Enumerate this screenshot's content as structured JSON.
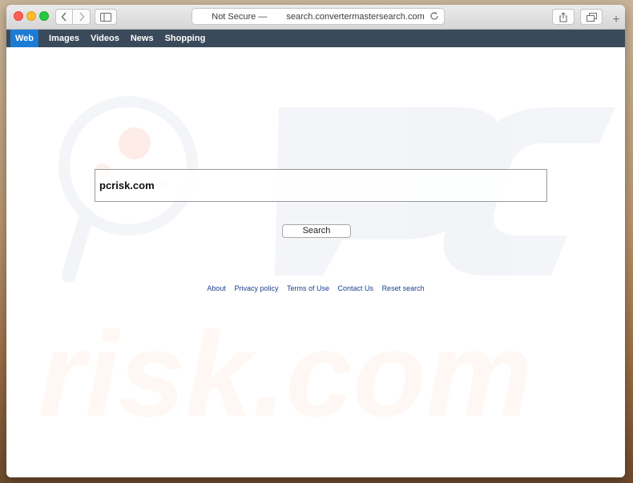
{
  "browser": {
    "address_security": "Not Secure —",
    "address_url": "search.convertermastersearch.com",
    "new_tab_label": "+"
  },
  "navbar": {
    "items": [
      {
        "label": "Web",
        "active": true
      },
      {
        "label": "Images",
        "active": false
      },
      {
        "label": "Videos",
        "active": false
      },
      {
        "label": "News",
        "active": false
      },
      {
        "label": "Shopping",
        "active": false
      }
    ]
  },
  "search": {
    "value": "pcrisk.com",
    "button_label": "Search"
  },
  "footer": {
    "links": [
      "About",
      "Privacy policy",
      "Terms of Use",
      "Contact Us",
      "Reset search"
    ]
  },
  "colors": {
    "navbar_bg": "#3a4a5a",
    "nav_active": "#1e7bd3",
    "link": "#1a3f8a"
  },
  "icons": {
    "back": "chevron-left-icon",
    "forward": "chevron-right-icon",
    "sidebar": "sidebar-icon",
    "reload": "reload-icon",
    "share": "share-icon",
    "tabs": "tabs-overview-icon"
  }
}
